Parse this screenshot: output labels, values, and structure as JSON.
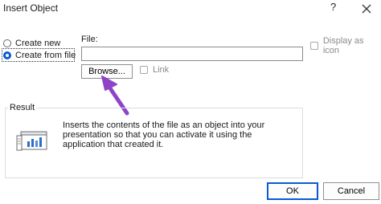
{
  "window": {
    "title": "Insert Object",
    "help_icon": "?",
    "close_icon": "close-icon"
  },
  "options": {
    "create_new_label": "Create new",
    "create_from_file_label": "Create from file",
    "selected": "create_from_file"
  },
  "file": {
    "label": "File:",
    "value": "",
    "browse_label": "Browse...",
    "link_label": "Link",
    "link_checked": false
  },
  "display_as_icon": {
    "label": "Display as icon",
    "checked": false
  },
  "result": {
    "label": "Result",
    "description": "Inserts the contents of the file as an object into your presentation so that you can activate it using the application that created it."
  },
  "buttons": {
    "ok_label": "OK",
    "cancel_label": "Cancel"
  },
  "colors": {
    "accent": "#0a5bd3",
    "arrow": "#8e44c9"
  }
}
